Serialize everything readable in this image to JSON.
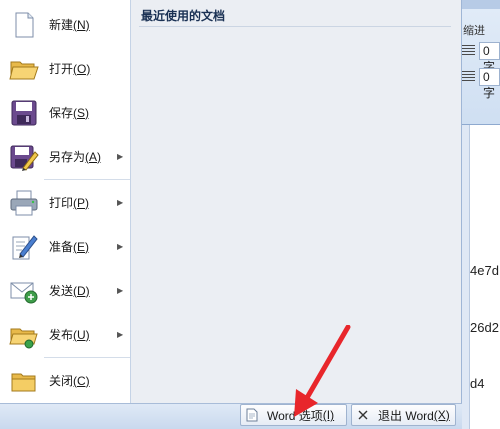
{
  "menu": {
    "items": [
      {
        "key": "new",
        "label": "新建",
        "mnemonic": "(N)",
        "submenu": false,
        "icon": "new-document-icon"
      },
      {
        "key": "open",
        "label": "打开",
        "mnemonic": "(O)",
        "submenu": false,
        "icon": "open-folder-icon"
      },
      {
        "key": "save",
        "label": "保存",
        "mnemonic": "(S)",
        "submenu": false,
        "icon": "save-floppy-icon"
      },
      {
        "key": "save-as",
        "label": "另存为",
        "mnemonic": "(A)",
        "submenu": true,
        "icon": "save-as-icon"
      },
      {
        "key": "print",
        "label": "打印",
        "mnemonic": "(P)",
        "submenu": true,
        "icon": "printer-icon"
      },
      {
        "key": "prepare",
        "label": "准备",
        "mnemonic": "(E)",
        "submenu": true,
        "icon": "prepare-document-icon"
      },
      {
        "key": "send",
        "label": "发送",
        "mnemonic": "(D)",
        "submenu": true,
        "icon": "send-mail-icon"
      },
      {
        "key": "publish",
        "label": "发布",
        "mnemonic": "(U)",
        "submenu": true,
        "icon": "publish-folder-icon"
      },
      {
        "key": "close",
        "label": "关闭",
        "mnemonic": "(C)",
        "submenu": false,
        "icon": "close-folder-icon"
      }
    ],
    "submenu_glyph": "▶"
  },
  "recent": {
    "title": "最近使用的文档"
  },
  "bottom_bar": {
    "options": {
      "label": "Word 选项",
      "mnemonic": "(I)"
    },
    "exit": {
      "label": "退出 Word",
      "mnemonic": "(X)"
    }
  },
  "background": {
    "ribbon_indent": "缩进",
    "spacing_before": "0 字",
    "spacing_after": "0 字",
    "doc_lines": [
      "4e7d",
      "26d2",
      "d4"
    ]
  },
  "colors": {
    "accent": "#1a3154",
    "pointer": "#e8262b"
  }
}
